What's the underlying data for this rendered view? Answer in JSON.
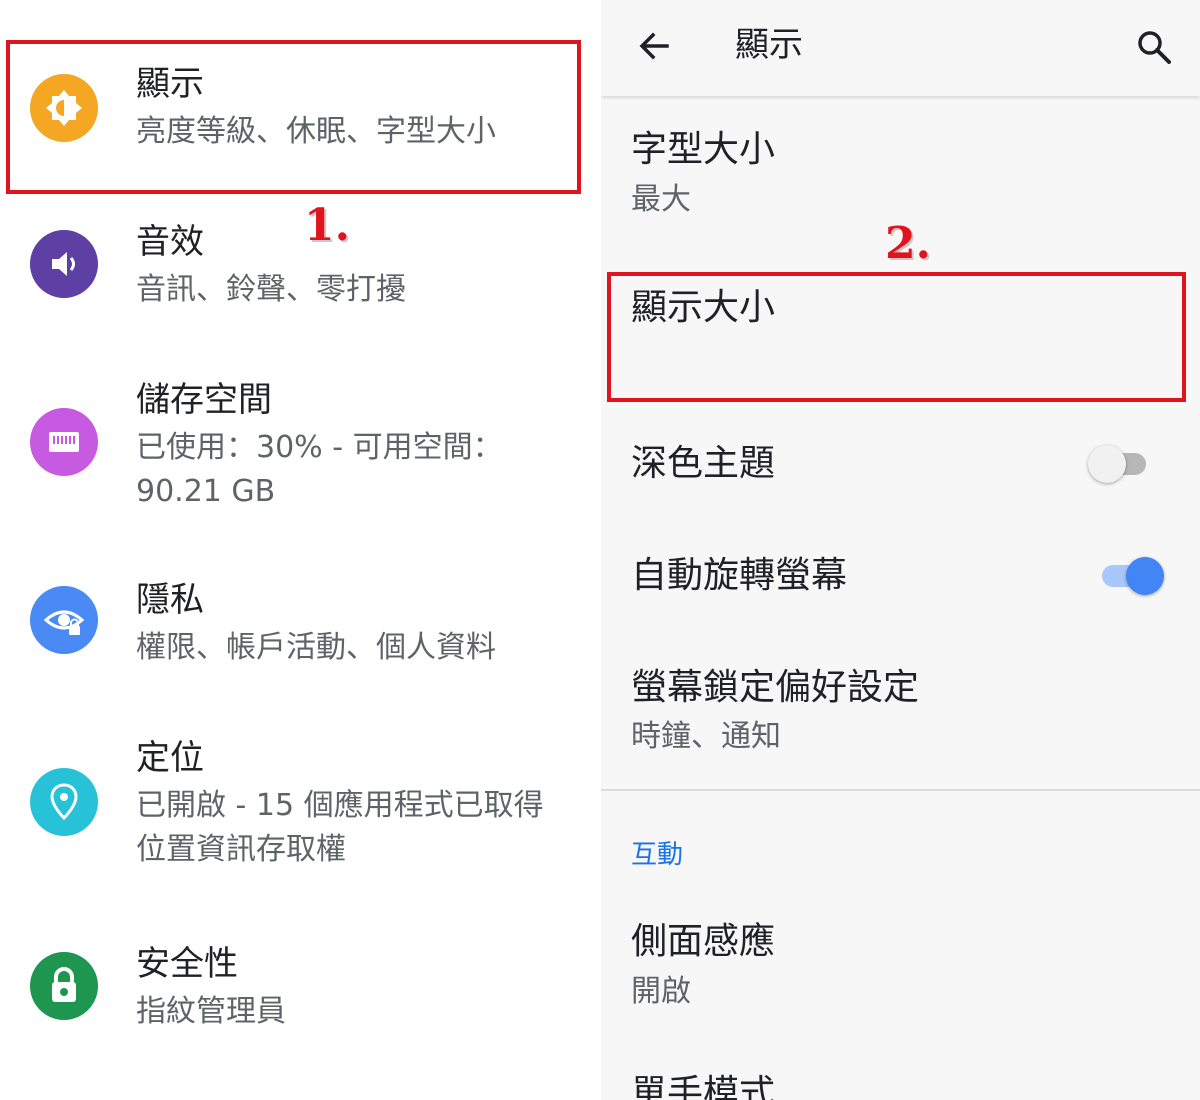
{
  "left_menu": {
    "items": [
      {
        "title": "顯示",
        "summary": "亮度等級、休眠、字型大小",
        "icon": "brightness-icon",
        "color": "#f5a623"
      },
      {
        "title": "音效",
        "summary": "音訊、鈴聲、零打擾",
        "icon": "volume-icon",
        "color": "#5e3fa3"
      },
      {
        "title": "儲存空間",
        "summary": "已使用：30% - 可用空間：90.21 GB",
        "icon": "storage-icon",
        "color": "#c65ae0"
      },
      {
        "title": "隱私",
        "summary": "權限、帳戶活動、個人資料",
        "icon": "privacy-eye-icon",
        "color": "#4a8af4"
      },
      {
        "title": "定位",
        "summary": "已開啟 - 15 個應用程式已取得位置資訊存取權",
        "icon": "location-pin-icon",
        "color": "#27c2d8"
      },
      {
        "title": "安全性",
        "summary": "指紋管理員",
        "icon": "lock-icon",
        "color": "#1e9650"
      }
    ]
  },
  "annotations": {
    "step1": "1.",
    "step2": "2."
  },
  "display_screen": {
    "title": "顯示",
    "back_icon": "arrow-back-icon",
    "search_icon": "search-icon",
    "font_size": {
      "title": "字型大小",
      "value": "最大"
    },
    "display_size": {
      "title": "顯示大小"
    },
    "dark_theme": {
      "title": "深色主題",
      "enabled": false
    },
    "auto_rotate": {
      "title": "自動旋轉螢幕",
      "enabled": true
    },
    "lock_screen": {
      "title": "螢幕鎖定偏好設定",
      "summary": "時鐘、通知"
    },
    "interaction_header": "互動",
    "side_sense": {
      "title": "側面感應",
      "value": "開啟"
    },
    "one_hand_partial": "單手模式"
  },
  "colors": {
    "accent": "#1a73e8",
    "annotation_red": "#e0141e",
    "toggle_on": "#4285f4"
  }
}
